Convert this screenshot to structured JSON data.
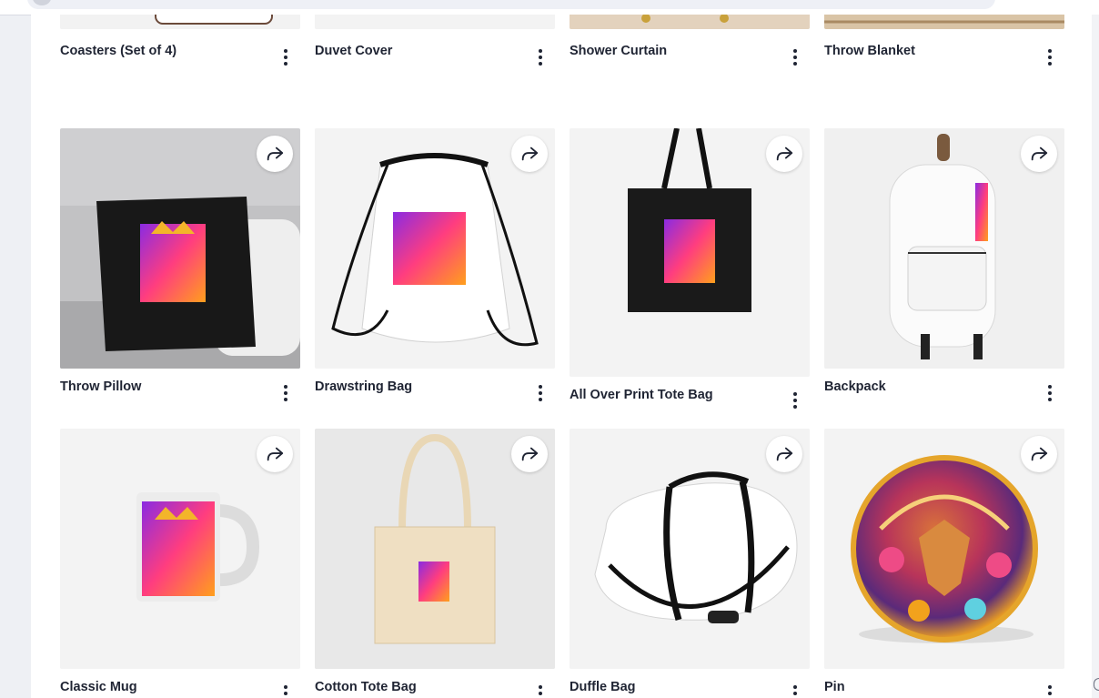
{
  "theme": {
    "page_bg": "#eef0f4",
    "card_bg": "#f3f3f4",
    "text": "#1f2433",
    "share_bg": "#ffffff"
  },
  "icons": {
    "share": "share-arrow-icon",
    "more": "more-vertical-icon"
  },
  "products": [
    {
      "title": "Coasters (Set of 4)"
    },
    {
      "title": "Duvet Cover"
    },
    {
      "title": "Shower Curtain"
    },
    {
      "title": "Throw Blanket"
    },
    {
      "title": "Throw Pillow"
    },
    {
      "title": "Drawstring Bag"
    },
    {
      "title": "All Over Print Tote Bag"
    },
    {
      "title": "Backpack"
    },
    {
      "title": "Classic Mug"
    },
    {
      "title": "Cotton Tote Bag"
    },
    {
      "title": "Duffle Bag"
    },
    {
      "title": "Pin"
    }
  ]
}
